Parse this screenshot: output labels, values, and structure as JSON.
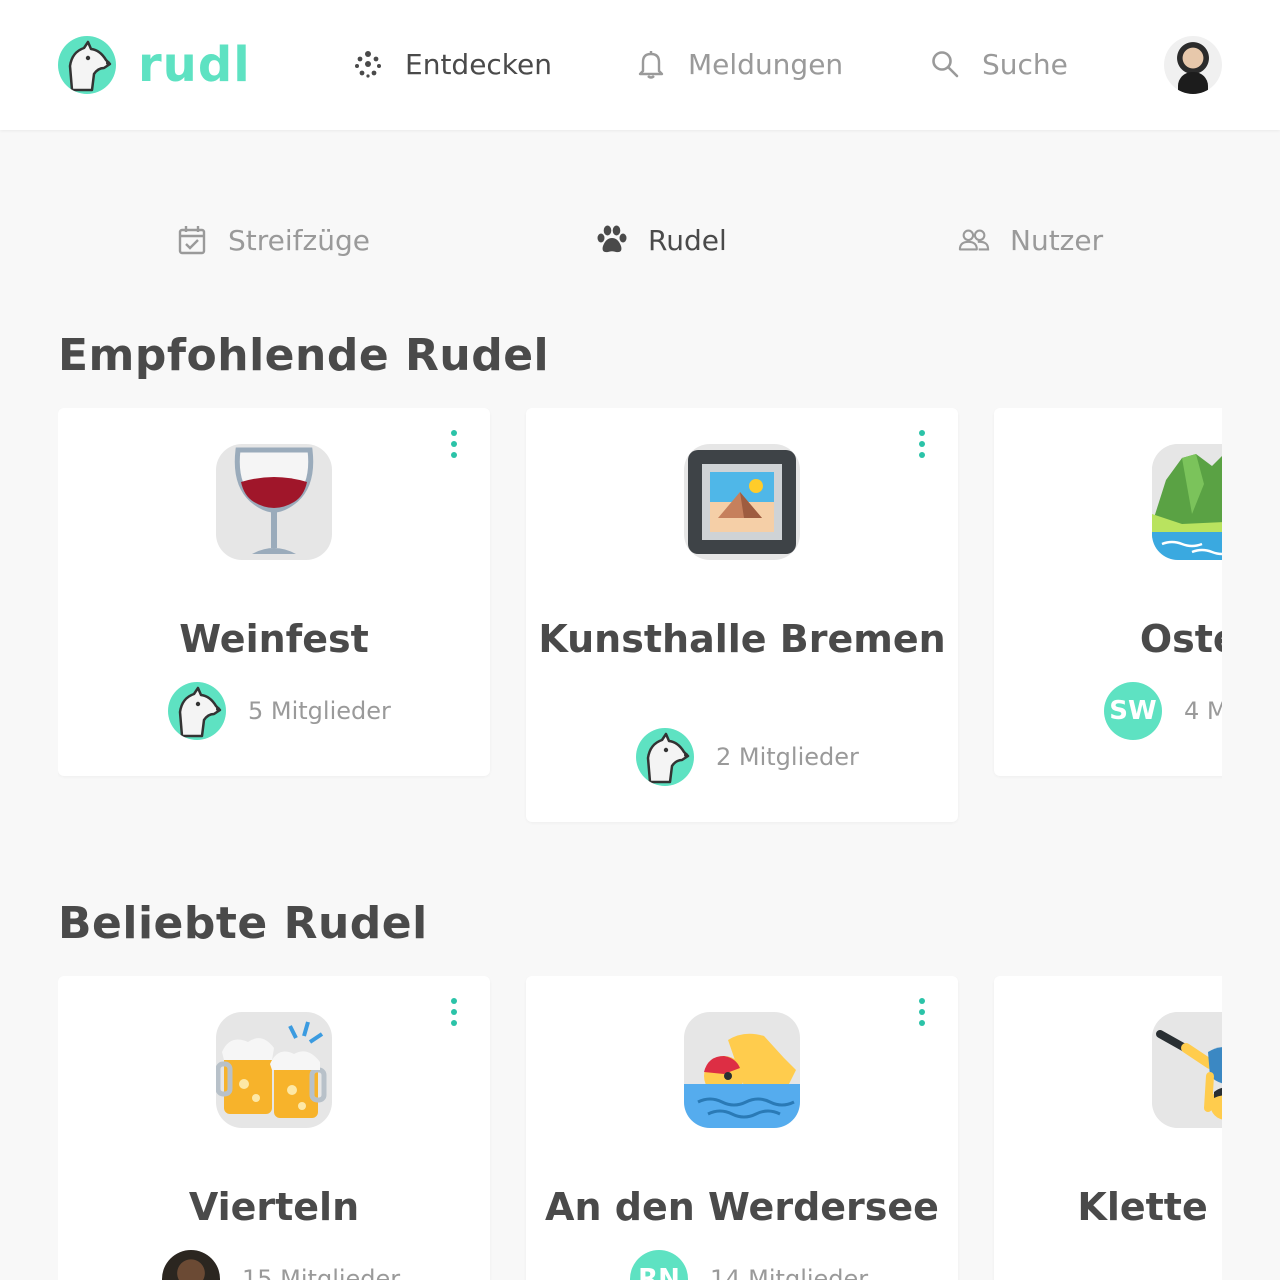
{
  "app": {
    "name": "rudl",
    "brand_color": "#5ee2c2",
    "accent_color": "#2bc3a8"
  },
  "nav": {
    "items": [
      {
        "label": "Entdecken",
        "icon": "dots-grid-icon",
        "active": true
      },
      {
        "label": "Meldungen",
        "icon": "bell-icon",
        "active": false
      },
      {
        "label": "Suche",
        "icon": "search-icon",
        "active": false
      }
    ],
    "avatar": "user-avatar"
  },
  "tabs": [
    {
      "label": "Streifzüge",
      "icon": "calendar-check-icon",
      "active": false
    },
    {
      "label": "Rudel",
      "icon": "paw-icon",
      "active": true
    },
    {
      "label": "Nutzer",
      "icon": "users-icon",
      "active": false
    }
  ],
  "sections": [
    {
      "title": "Empfohlende Rudel",
      "cards": [
        {
          "name": "Weinfest",
          "members": "5 Mitglieder",
          "icon": "wine-glass-emoji",
          "member_avatar": "wolf-logo"
        },
        {
          "name": "Kunsthalle Bremen",
          "members": "2 Mitglieder",
          "icon": "framed-picture-emoji",
          "member_avatar": "wolf-logo"
        },
        {
          "name": "Osterr",
          "members": "4 M",
          "icon": "mountain-lake-emoji",
          "member_avatar": "initials",
          "initials": "SW"
        }
      ]
    },
    {
      "title": "Beliebte Rudel",
      "cards": [
        {
          "name": "Vierteln",
          "members": "15 Mitglieder",
          "icon": "beer-mugs-emoji",
          "member_avatar": "photo"
        },
        {
          "name": "An den Werdersee",
          "members": "14 Mitglieder",
          "icon": "swimmer-emoji",
          "member_avatar": "initials",
          "initials": "RN"
        },
        {
          "name": "Klette Boulc",
          "members": "",
          "icon": "cartwheel-emoji",
          "member_avatar": "none"
        }
      ]
    }
  ]
}
